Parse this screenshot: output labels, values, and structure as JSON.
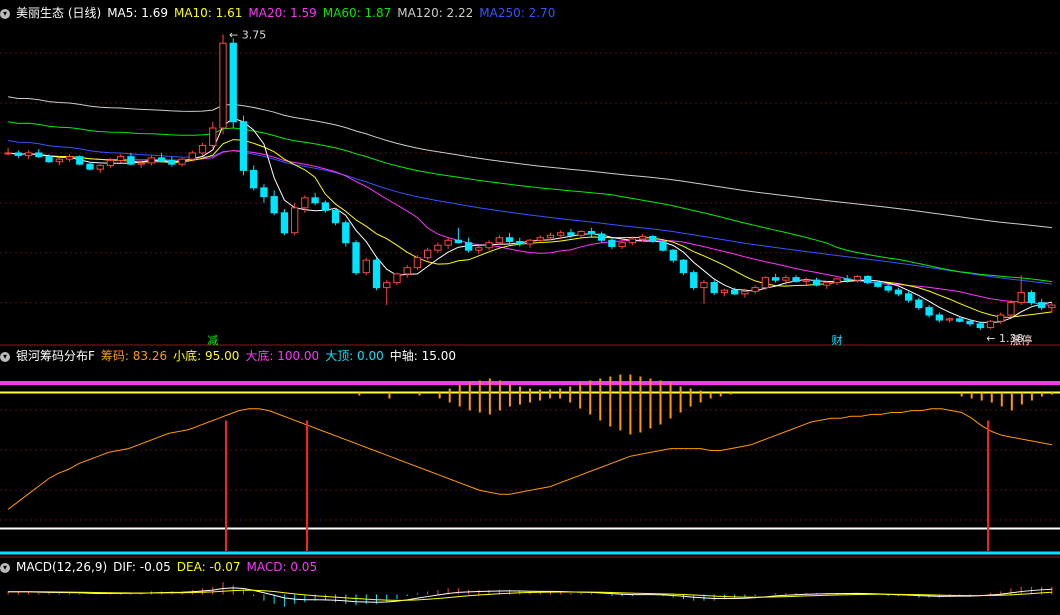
{
  "colors": {
    "up": "#ff4444",
    "down": "#00e5ff",
    "ma5": "#ffffff",
    "ma10": "#ffff00",
    "ma20": "#ff33ff",
    "ma60": "#00ee00",
    "ma120": "#cccccc",
    "ma250": "#3355ff",
    "bar": "#ff9900",
    "line": "#ff9900",
    "red_line": "#ff2222"
  },
  "panel1": {
    "legend": [
      {
        "text": "美丽生态 (日线)",
        "color": "#ffffff"
      },
      {
        "text": "MA5: 1.69",
        "color": "#ffffff"
      },
      {
        "text": "MA10: 1.61",
        "color": "#ffff00"
      },
      {
        "text": "MA20: 1.59",
        "color": "#ff33ff"
      },
      {
        "text": "MA60: 1.87",
        "color": "#00ee00"
      },
      {
        "text": "MA120: 2.22",
        "color": "#cccccc"
      },
      {
        "text": "MA250: 2.70",
        "color": "#3355ff"
      }
    ],
    "high_label": "3.75",
    "low_label": "1.38",
    "annotations": [
      "减",
      "财",
      "涨停"
    ]
  },
  "panel2": {
    "legend": [
      {
        "text": "银河筹码分布F",
        "color": "#ffffff"
      },
      {
        "text": "筹码: 83.26",
        "color": "#ff9900"
      },
      {
        "text": "小底: 95.00",
        "color": "#ffff00"
      },
      {
        "text": "大底: 100.00",
        "color": "#ff33ff"
      },
      {
        "text": "大顶: 0.00",
        "color": "#00e5ff"
      },
      {
        "text": "中轴: 15.00",
        "color": "#ffffff"
      }
    ]
  },
  "panel3": {
    "legend": [
      {
        "text": "MACD(12,26,9)",
        "color": "#ffffff"
      },
      {
        "text": "DIF: -0.05",
        "color": "#ffffff"
      },
      {
        "text": "DEA: -0.07",
        "color": "#ffff00"
      },
      {
        "text": "MACD: 0.05",
        "color": "#ff33ff"
      }
    ]
  },
  "chart_data": {
    "type": "candlestick",
    "price_range": [
      1.3,
      3.85
    ],
    "candles": [
      [
        2.8,
        2.84,
        2.78,
        2.8
      ],
      [
        2.8,
        2.82,
        2.76,
        2.78
      ],
      [
        2.78,
        2.82,
        2.75,
        2.8
      ],
      [
        2.8,
        2.83,
        2.76,
        2.77
      ],
      [
        2.77,
        2.79,
        2.72,
        2.73
      ],
      [
        2.73,
        2.77,
        2.7,
        2.75
      ],
      [
        2.75,
        2.79,
        2.73,
        2.77
      ],
      [
        2.77,
        2.78,
        2.7,
        2.71
      ],
      [
        2.71,
        2.73,
        2.66,
        2.67
      ],
      [
        2.67,
        2.71,
        2.64,
        2.7
      ],
      [
        2.7,
        2.76,
        2.68,
        2.74
      ],
      [
        2.74,
        2.79,
        2.72,
        2.77
      ],
      [
        2.77,
        2.8,
        2.7,
        2.71
      ],
      [
        2.71,
        2.74,
        2.68,
        2.72
      ],
      [
        2.72,
        2.78,
        2.7,
        2.76
      ],
      [
        2.76,
        2.8,
        2.72,
        2.74
      ],
      [
        2.74,
        2.77,
        2.69,
        2.71
      ],
      [
        2.71,
        2.76,
        2.69,
        2.75
      ],
      [
        2.75,
        2.82,
        2.73,
        2.8
      ],
      [
        2.8,
        2.88,
        2.78,
        2.86
      ],
      [
        2.86,
        3.05,
        2.84,
        3.0
      ],
      [
        3.0,
        3.75,
        2.95,
        3.68
      ],
      [
        3.68,
        3.72,
        3.0,
        3.05
      ],
      [
        3.05,
        3.1,
        2.62,
        2.66
      ],
      [
        2.66,
        2.7,
        2.5,
        2.52
      ],
      [
        2.52,
        2.55,
        2.4,
        2.45
      ],
      [
        2.45,
        2.5,
        2.3,
        2.32
      ],
      [
        2.32,
        2.35,
        2.14,
        2.16
      ],
      [
        2.16,
        2.4,
        2.14,
        2.36
      ],
      [
        2.36,
        2.46,
        2.32,
        2.44
      ],
      [
        2.44,
        2.48,
        2.38,
        2.4
      ],
      [
        2.4,
        2.42,
        2.32,
        2.34
      ],
      [
        2.34,
        2.36,
        2.22,
        2.24
      ],
      [
        2.24,
        2.26,
        2.05,
        2.08
      ],
      [
        2.08,
        2.1,
        1.82,
        1.84
      ],
      [
        1.84,
        1.96,
        1.82,
        1.94
      ],
      [
        1.94,
        1.96,
        1.7,
        1.72
      ],
      [
        1.72,
        1.78,
        1.58,
        1.76
      ],
      [
        1.76,
        1.84,
        1.74,
        1.83
      ],
      [
        1.83,
        1.9,
        1.8,
        1.88
      ],
      [
        1.88,
        1.98,
        1.86,
        1.96
      ],
      [
        1.96,
        2.04,
        1.94,
        2.02
      ],
      [
        2.02,
        2.08,
        2.0,
        2.06
      ],
      [
        2.06,
        2.12,
        2.03,
        2.1
      ],
      [
        2.1,
        2.2,
        2.08,
        2.08
      ],
      [
        2.08,
        2.12,
        2.0,
        2.02
      ],
      [
        2.02,
        2.06,
        1.99,
        2.04
      ],
      [
        2.04,
        2.1,
        2.02,
        2.08
      ],
      [
        2.08,
        2.14,
        2.06,
        2.12
      ],
      [
        2.12,
        2.16,
        2.07,
        2.09
      ],
      [
        2.09,
        2.12,
        2.05,
        2.07
      ],
      [
        2.07,
        2.11,
        2.04,
        2.1
      ],
      [
        2.1,
        2.14,
        2.08,
        2.12
      ],
      [
        2.12,
        2.16,
        2.1,
        2.14
      ],
      [
        2.14,
        2.18,
        2.11,
        2.16
      ],
      [
        2.16,
        2.19,
        2.12,
        2.14
      ],
      [
        2.14,
        2.18,
        2.12,
        2.17
      ],
      [
        2.17,
        2.2,
        2.13,
        2.15
      ],
      [
        2.15,
        2.17,
        2.08,
        2.1
      ],
      [
        2.1,
        2.12,
        2.03,
        2.05
      ],
      [
        2.05,
        2.09,
        2.03,
        2.08
      ],
      [
        2.08,
        2.13,
        2.06,
        2.11
      ],
      [
        2.11,
        2.15,
        2.09,
        2.13
      ],
      [
        2.13,
        2.14,
        2.08,
        2.09
      ],
      [
        2.09,
        2.1,
        2.01,
        2.02
      ],
      [
        2.02,
        2.03,
        1.92,
        1.94
      ],
      [
        1.94,
        1.95,
        1.82,
        1.84
      ],
      [
        1.84,
        1.86,
        1.7,
        1.72
      ],
      [
        1.72,
        1.78,
        1.59,
        1.76
      ],
      [
        1.76,
        1.78,
        1.66,
        1.68
      ],
      [
        1.68,
        1.71,
        1.65,
        1.7
      ],
      [
        1.7,
        1.72,
        1.66,
        1.67
      ],
      [
        1.67,
        1.71,
        1.64,
        1.69
      ],
      [
        1.69,
        1.74,
        1.67,
        1.72
      ],
      [
        1.72,
        1.81,
        1.7,
        1.8
      ],
      [
        1.8,
        1.83,
        1.76,
        1.78
      ],
      [
        1.78,
        1.82,
        1.74,
        1.8
      ],
      [
        1.8,
        1.82,
        1.76,
        1.77
      ],
      [
        1.77,
        1.8,
        1.74,
        1.78
      ],
      [
        1.78,
        1.8,
        1.73,
        1.74
      ],
      [
        1.74,
        1.77,
        1.71,
        1.76
      ],
      [
        1.76,
        1.8,
        1.74,
        1.79
      ],
      [
        1.79,
        1.82,
        1.76,
        1.78
      ],
      [
        1.78,
        1.82,
        1.76,
        1.81
      ],
      [
        1.81,
        1.82,
        1.75,
        1.76
      ],
      [
        1.76,
        1.78,
        1.72,
        1.73
      ],
      [
        1.73,
        1.75,
        1.68,
        1.7
      ],
      [
        1.7,
        1.72,
        1.65,
        1.67
      ],
      [
        1.67,
        1.69,
        1.6,
        1.62
      ],
      [
        1.62,
        1.64,
        1.54,
        1.56
      ],
      [
        1.56,
        1.58,
        1.48,
        1.5
      ],
      [
        1.5,
        1.52,
        1.44,
        1.46
      ],
      [
        1.46,
        1.48,
        1.44,
        1.47
      ],
      [
        1.47,
        1.49,
        1.44,
        1.45
      ],
      [
        1.45,
        1.47,
        1.41,
        1.43
      ],
      [
        1.43,
        1.44,
        1.38,
        1.4
      ],
      [
        1.4,
        1.46,
        1.39,
        1.45
      ],
      [
        1.45,
        1.52,
        1.43,
        1.5
      ],
      [
        1.5,
        1.62,
        1.48,
        1.6
      ],
      [
        1.6,
        1.82,
        1.58,
        1.68
      ],
      [
        1.68,
        1.7,
        1.58,
        1.6
      ],
      [
        1.6,
        1.63,
        1.54,
        1.56
      ],
      [
        1.56,
        1.6,
        1.52,
        1.58
      ]
    ],
    "chip": [
      24,
      28,
      32,
      36,
      40,
      43,
      45,
      48,
      50,
      52,
      54,
      55,
      56,
      58,
      60,
      62,
      64,
      65,
      66,
      68,
      70,
      72,
      74,
      76,
      77,
      77,
      76,
      74,
      72,
      70,
      68,
      66,
      64,
      62,
      60,
      58,
      56,
      54,
      52,
      50,
      48,
      46,
      44,
      42,
      40,
      38,
      36,
      34,
      33,
      32,
      32,
      33,
      34,
      35,
      36,
      38,
      40,
      42,
      44,
      46,
      48,
      50,
      52,
      53,
      54,
      55,
      56,
      56,
      56,
      56,
      55,
      55,
      56,
      57,
      58,
      60,
      62,
      64,
      66,
      68,
      70,
      71,
      72,
      72,
      73,
      73,
      74,
      74,
      75,
      75,
      76,
      76,
      77,
      77,
      76,
      75,
      72,
      68,
      65,
      63,
      62,
      61,
      60,
      59,
      58
    ],
    "chip_bars": [
      0,
      0,
      0,
      0,
      0,
      0,
      0,
      0,
      0,
      0,
      0,
      0,
      0,
      0,
      0,
      0,
      0,
      0,
      0,
      0,
      0,
      0,
      0,
      0,
      0,
      0,
      0,
      0,
      0,
      0,
      0,
      0,
      0,
      0,
      0,
      -3,
      0,
      0,
      -6,
      0,
      0,
      -3,
      0,
      -6,
      -10,
      -14,
      -18,
      -20,
      -22,
      -18,
      -14,
      -12,
      -10,
      -8,
      -6,
      -6,
      -10,
      -16,
      -22,
      -28,
      -34,
      -38,
      -42,
      -40,
      -36,
      -32,
      -26,
      -20,
      -14,
      -10,
      -6,
      -4,
      -2,
      0,
      0,
      0,
      0,
      0,
      0,
      0,
      0,
      0,
      0,
      0,
      0,
      0,
      0,
      0,
      0,
      0,
      0,
      0,
      0,
      0,
      0,
      -4,
      -6,
      -8,
      -10,
      -14,
      -18,
      -12,
      -8,
      -4,
      -2
    ],
    "chip_pos_bars": [
      0,
      0,
      0,
      0,
      0,
      0,
      0,
      0,
      0,
      0,
      0,
      0,
      0,
      0,
      0,
      0,
      0,
      0,
      0,
      0,
      0,
      0,
      0,
      0,
      0,
      0,
      0,
      0,
      0,
      0,
      0,
      0,
      0,
      0,
      0,
      0,
      0,
      0,
      0,
      0,
      0,
      0,
      0,
      0,
      4,
      8,
      10,
      12,
      14,
      12,
      8,
      6,
      4,
      3,
      3,
      4,
      6,
      10,
      12,
      14,
      16,
      18,
      18,
      16,
      14,
      12,
      10,
      6,
      4,
      2,
      0,
      0,
      0,
      0,
      0,
      0,
      0,
      0,
      0,
      0,
      0,
      0,
      0,
      0,
      0,
      0,
      0,
      0,
      0,
      0,
      0,
      0,
      0,
      0,
      0,
      0,
      0,
      0,
      0,
      0,
      0,
      0,
      0,
      0,
      0
    ],
    "red_signals": [
      55,
      75,
      243
    ],
    "levels": {
      "big_bottom": 100,
      "small_bottom": 95,
      "axis": 15,
      "top": 0
    },
    "macd_hist": [
      0.02,
      0.02,
      0.02,
      0.01,
      0.01,
      0.01,
      0.01,
      0.01,
      0.0,
      0.0,
      0.01,
      0.01,
      0.01,
      0.01,
      0.02,
      0.02,
      0.02,
      0.02,
      0.03,
      0.04,
      0.05,
      0.08,
      0.06,
      0.03,
      -0.01,
      -0.04,
      -0.06,
      -0.08,
      -0.06,
      -0.05,
      -0.04,
      -0.04,
      -0.05,
      -0.06,
      -0.07,
      -0.06,
      -0.06,
      -0.05,
      -0.03,
      -0.01,
      0.01,
      0.02,
      0.03,
      0.04,
      0.04,
      0.03,
      0.03,
      0.03,
      0.03,
      0.03,
      0.02,
      0.02,
      0.02,
      0.02,
      0.02,
      0.01,
      0.01,
      0.01,
      0.0,
      -0.01,
      -0.01,
      -0.01,
      0.0,
      0.0,
      -0.01,
      -0.02,
      -0.03,
      -0.04,
      -0.04,
      -0.04,
      -0.03,
      -0.03,
      -0.02,
      -0.01,
      0.0,
      0.01,
      0.01,
      0.01,
      0.01,
      0.01,
      0.01,
      0.01,
      0.01,
      0.01,
      0.0,
      0.0,
      -0.01,
      -0.01,
      -0.01,
      -0.02,
      -0.02,
      -0.02,
      -0.01,
      -0.01,
      -0.01,
      0.0,
      0.01,
      0.02,
      0.04,
      0.05,
      0.05,
      0.05,
      0.05
    ],
    "macd_range": [
      -0.12,
      0.12
    ]
  }
}
